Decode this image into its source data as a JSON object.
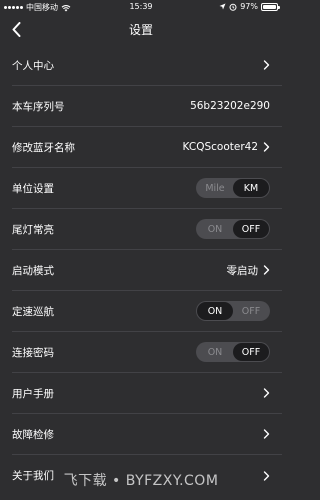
{
  "status_bar": {
    "carrier": "中国移动",
    "time": "15:39",
    "battery_percent": "97%",
    "battery_level": 0.97
  },
  "nav": {
    "title": "设置"
  },
  "rows": {
    "personal_center": {
      "label": "个人中心"
    },
    "serial": {
      "label": "本车序列号",
      "value": "56b23202e290"
    },
    "bluetooth": {
      "label": "修改蓝牙名称",
      "value": "KCQScooter42"
    },
    "unit": {
      "label": "单位设置",
      "options": [
        "Mile",
        "KM"
      ],
      "selected": "KM"
    },
    "taillight": {
      "label": "尾灯常亮",
      "options": [
        "ON",
        "OFF"
      ],
      "selected": "OFF"
    },
    "start_mode": {
      "label": "启动模式",
      "value": "零启动"
    },
    "cruise": {
      "label": "定速巡航",
      "options": [
        "ON",
        "OFF"
      ],
      "selected": "ON"
    },
    "password": {
      "label": "连接密码",
      "options": [
        "ON",
        "OFF"
      ],
      "selected": "OFF"
    },
    "manual": {
      "label": "用户手册"
    },
    "repair": {
      "label": "故障检修"
    },
    "about": {
      "label": "关于我们"
    }
  },
  "watermark": "飞下载 • BYFZXY.COM",
  "icons": {
    "back": "chevron-left-icon",
    "disclosure": "chevron-right-icon",
    "wifi": "wifi-icon",
    "location": "location-arrow-icon",
    "alarm": "alarm-icon",
    "battery": "battery-icon"
  }
}
